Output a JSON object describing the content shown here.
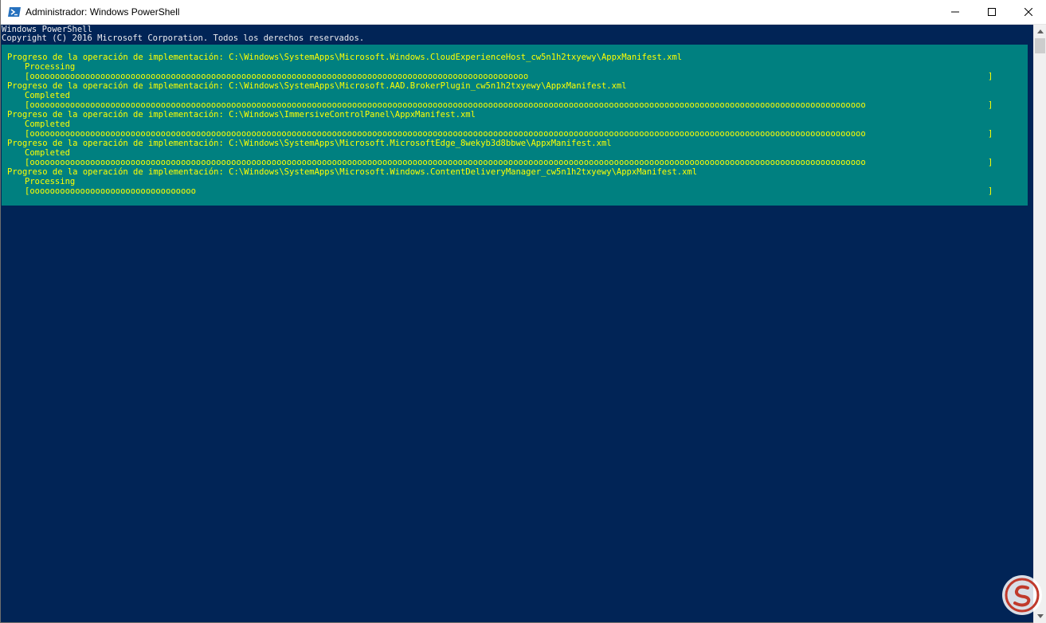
{
  "window": {
    "title": "Administrador: Windows PowerShell",
    "minimize_icon": "minimize-icon",
    "maximize_icon": "maximize-icon",
    "close_icon": "close-icon"
  },
  "console": {
    "header": [
      "Windows PowerShell",
      "Copyright (C) 2016 Microsoft Corporation. Todos los derechos reservados."
    ],
    "colors": {
      "background": "#012456",
      "progress_background": "#008080",
      "progress_text": "#ffff00",
      "header_text": "#eeedf0"
    },
    "progress_records": [
      {
        "activity": "Progreso de la operación de implementación: C:\\Windows\\SystemApps\\Microsoft.Windows.CloudExperienceHost_cw5n1h2txyewy\\AppxManifest.xml",
        "status": "Processing",
        "bar": "[ooooooooooooooooooooooooooooooooooooooooooooooooooooooooooooooooooooooooooooooooooooooooooooooooooo",
        "bar_end": "]",
        "percent": 60
      },
      {
        "activity": "Progreso de la operación de implementación: C:\\Windows\\SystemApps\\Microsoft.AAD.BrokerPlugin_cw5n1h2txyewy\\AppxManifest.xml",
        "status": "Completed",
        "bar": "[oooooooooooooooooooooooooooooooooooooooooooooooooooooooooooooooooooooooooooooooooooooooooooooooooooooooooooooooooooooooooooooooooooooooooooooooooooooooooooooooooooooo",
        "bar_end": "]",
        "percent": 100
      },
      {
        "activity": "Progreso de la operación de implementación: C:\\Windows\\ImmersiveControlPanel\\AppxManifest.xml",
        "status": "Completed",
        "bar": "[oooooooooooooooooooooooooooooooooooooooooooooooooooooooooooooooooooooooooooooooooooooooooooooooooooooooooooooooooooooooooooooooooooooooooooooooooooooooooooooooooooooo",
        "bar_end": "]",
        "percent": 100
      },
      {
        "activity": "Progreso de la operación de implementación: C:\\Windows\\SystemApps\\Microsoft.MicrosoftEdge_8wekyb3d8bbwe\\AppxManifest.xml",
        "status": "Completed",
        "bar": "[oooooooooooooooooooooooooooooooooooooooooooooooooooooooooooooooooooooooooooooooooooooooooooooooooooooooooooooooooooooooooooooooooooooooooooooooooooooooooooooooooooooo",
        "bar_end": "]",
        "percent": 100
      },
      {
        "activity": "Progreso de la operación de implementación: C:\\Windows\\SystemApps\\Microsoft.Windows.ContentDeliveryManager_cw5n1h2txyewy\\AppxManifest.xml",
        "status": "Processing",
        "bar": "[ooooooooooooooooooooooooooooooooo",
        "bar_end": "]",
        "percent": 20
      }
    ]
  },
  "scrollbar": {
    "up_icon": "scroll-up-arrow-icon",
    "down_icon": "scroll-down-arrow-icon"
  },
  "watermark": {
    "icon": "site-logo-icon"
  }
}
